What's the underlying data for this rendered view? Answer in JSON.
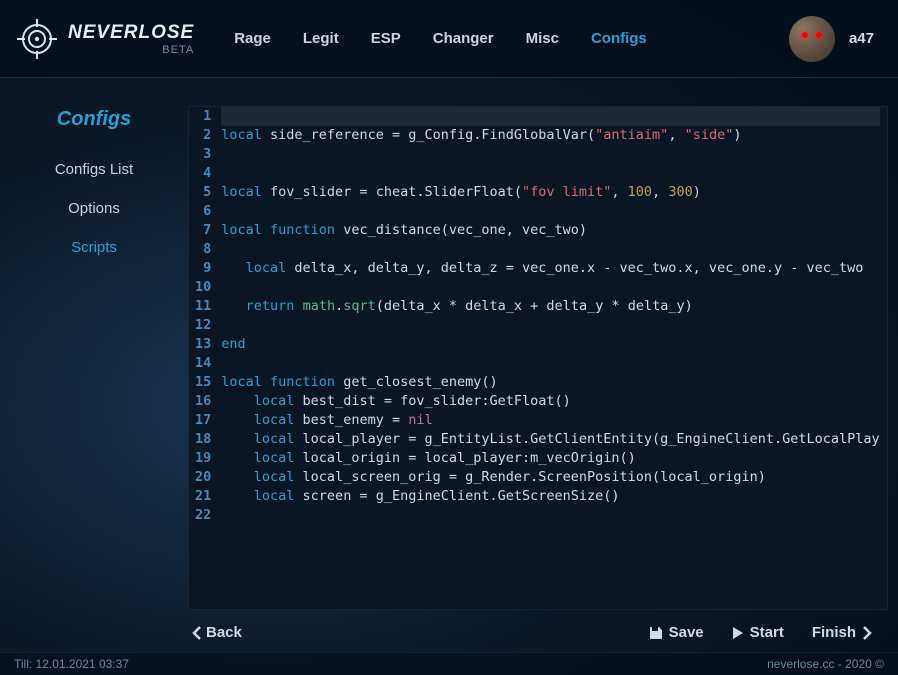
{
  "brand": {
    "name": "NEVERLOSE",
    "tag": "BETA"
  },
  "nav": {
    "items": [
      "Rage",
      "Legit",
      "ESP",
      "Changer",
      "Misc",
      "Configs"
    ],
    "active_index": 5
  },
  "user": {
    "name": "a47"
  },
  "sidebar": {
    "title": "Configs",
    "items": [
      "Configs List",
      "Options",
      "Scripts"
    ],
    "active_index": 2
  },
  "toolbar": {
    "back": "Back",
    "save": "Save",
    "start": "Start",
    "finish": "Finish"
  },
  "footer": {
    "left": "Till: 12.01.2021 03:37",
    "right": "neverlose.cc - 2020 ©"
  },
  "code": {
    "lines": [
      {
        "n": 1,
        "t": []
      },
      {
        "n": 2,
        "t": [
          [
            "kw",
            "local"
          ],
          [
            "",
            " side_reference = g_Config.FindGlobalVar("
          ],
          [
            "str",
            "\"antiaim\""
          ],
          [
            "",
            ", "
          ],
          [
            "str",
            "\"side\""
          ],
          [
            "",
            ")"
          ]
        ]
      },
      {
        "n": 3,
        "t": []
      },
      {
        "n": 4,
        "t": []
      },
      {
        "n": 5,
        "t": [
          [
            "kw",
            "local"
          ],
          [
            "",
            " fov_slider = cheat.SliderFloat("
          ],
          [
            "str",
            "\"fov limit\""
          ],
          [
            "",
            ", "
          ],
          [
            "num",
            "100"
          ],
          [
            "",
            ", "
          ],
          [
            "num",
            "300"
          ],
          [
            "",
            ")"
          ]
        ]
      },
      {
        "n": 6,
        "t": []
      },
      {
        "n": 7,
        "t": [
          [
            "kw",
            "local function"
          ],
          [
            "",
            " vec_distance(vec_one, vec_two)"
          ]
        ]
      },
      {
        "n": 8,
        "t": []
      },
      {
        "n": 9,
        "t": [
          [
            "",
            "   "
          ],
          [
            "kw",
            "local"
          ],
          [
            "",
            " delta_x, delta_y, delta_z = vec_one.x - vec_two.x, vec_one.y - vec_two"
          ]
        ]
      },
      {
        "n": 10,
        "t": []
      },
      {
        "n": 11,
        "t": [
          [
            "",
            "   "
          ],
          [
            "kw",
            "return"
          ],
          [
            "",
            " "
          ],
          [
            "fn",
            "math"
          ],
          [
            "",
            "."
          ],
          [
            "fn",
            "sqrt"
          ],
          [
            "",
            "(delta_x * delta_x + delta_y * delta_y)"
          ]
        ]
      },
      {
        "n": 12,
        "t": []
      },
      {
        "n": 13,
        "t": [
          [
            "kw",
            "end"
          ]
        ]
      },
      {
        "n": 14,
        "t": []
      },
      {
        "n": 15,
        "t": [
          [
            "kw",
            "local function"
          ],
          [
            "",
            " get_closest_enemy()"
          ]
        ]
      },
      {
        "n": 16,
        "t": [
          [
            "",
            "    "
          ],
          [
            "kw",
            "local"
          ],
          [
            "",
            " best_dist = fov_slider:GetFloat()"
          ]
        ]
      },
      {
        "n": 17,
        "t": [
          [
            "",
            "    "
          ],
          [
            "kw",
            "local"
          ],
          [
            "",
            " best_enemy = "
          ],
          [
            "nilv",
            "nil"
          ]
        ]
      },
      {
        "n": 18,
        "t": [
          [
            "",
            "    "
          ],
          [
            "kw",
            "local"
          ],
          [
            "",
            " local_player = g_EntityList.GetClientEntity(g_EngineClient.GetLocalPlay"
          ]
        ]
      },
      {
        "n": 19,
        "t": [
          [
            "",
            "    "
          ],
          [
            "kw",
            "local"
          ],
          [
            "",
            " local_origin = local_player:m_vecOrigin()"
          ]
        ]
      },
      {
        "n": 20,
        "t": [
          [
            "",
            "    "
          ],
          [
            "kw",
            "local"
          ],
          [
            "",
            " local_screen_orig = g_Render.ScreenPosition(local_origin)"
          ]
        ]
      },
      {
        "n": 21,
        "t": [
          [
            "",
            "    "
          ],
          [
            "kw",
            "local"
          ],
          [
            "",
            " screen = g_EngineClient.GetScreenSize()"
          ]
        ]
      },
      {
        "n": 22,
        "t": []
      }
    ]
  }
}
